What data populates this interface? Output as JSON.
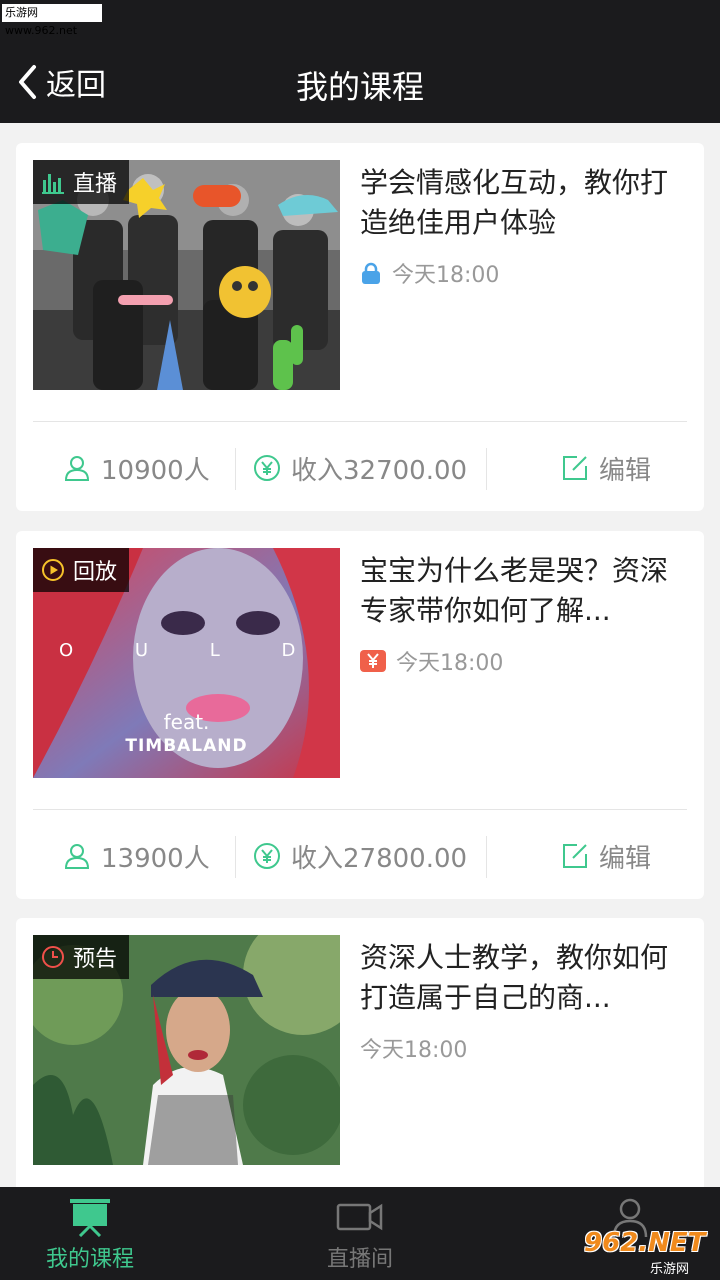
{
  "watermark_top": "乐游网 www.962.net",
  "nav": {
    "back_label": "返回",
    "title": "我的课程"
  },
  "courses": [
    {
      "badge": "直播",
      "badge_icon": "live-bars-icon",
      "title": "学会情感化互动，教你打造绝佳用户体验",
      "time_icon": "lock-icon",
      "time": "今天18:00",
      "people": "10900人",
      "income": "收入32700.00",
      "edit": "编辑"
    },
    {
      "badge": "回放",
      "badge_icon": "play-circle-icon",
      "title": "宝宝为什么老是哭？资深专家带你如何了解...",
      "time_icon": "yen-tag-icon",
      "time": "今天18:00",
      "people": "13900人",
      "income": "收入27800.00",
      "edit": "编辑"
    },
    {
      "badge": "预告",
      "badge_icon": "clock-icon",
      "title": "资深人士教学，教你如何打造属于自己的商...",
      "time": "今天18:00"
    }
  ],
  "art": {
    "album_letters": "O U L D E",
    "album_feat": "feat.",
    "album_artist": "TIMBALAND"
  },
  "tabs": [
    {
      "label": "我的课程",
      "icon": "presentation-board-icon",
      "active": true
    },
    {
      "label": "直播间",
      "icon": "video-camera-icon",
      "active": false
    },
    {
      "label": "",
      "icon": "person-icon",
      "active": false
    }
  ],
  "watermark_bottom": {
    "big": "962.NET",
    "small": "乐游网"
  },
  "colors": {
    "accent": "#3fc88e",
    "dark": "#1b1b1d",
    "lock_blue": "#4aa3e8",
    "yen_red": "#f0604a"
  }
}
